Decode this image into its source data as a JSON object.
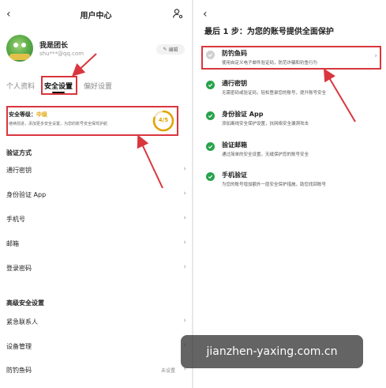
{
  "left": {
    "back_glyph": "‹",
    "title": "用户中心",
    "user": {
      "name": "我是团长",
      "email": "shu***@qq.com"
    },
    "edit_label": "编辑",
    "tabs": [
      "个人资料",
      "安全设置",
      "偏好设置"
    ],
    "security": {
      "level_label": "安全等级：",
      "level_value": "中级",
      "level_desc": "继续前进，添加更多安全设置，为您的账号安全保驾护航",
      "score": "4/5",
      "score_fraction": 0.8
    },
    "section1": "验证方式",
    "verify_items": [
      "通行密钥",
      "身份验证 App",
      "手机号",
      "邮箱",
      "登录密码"
    ],
    "section2": "高级安全设置",
    "advanced_items": [
      {
        "label": "紧急联系人",
        "status": ""
      },
      {
        "label": "设备管理",
        "status": ""
      },
      {
        "label": "防钓鱼码",
        "status": "未设置"
      }
    ]
  },
  "right": {
    "back_glyph": "‹",
    "title": "最后 1 步：为您的账号提供全面保护",
    "steps": [
      {
        "title": "防钓鱼码",
        "desc": "使用自定义电子邮件验证码，防范诈骗和钓鱼行为",
        "done": false
      },
      {
        "title": "通行密钥",
        "desc": "无需密码或验证码，轻松登录您的账号，提升账号安全",
        "done": true
      },
      {
        "title": "身份验证 App",
        "desc": "添加离线安全保护设置，抗网络安全漏洞攻击",
        "done": true
      },
      {
        "title": "验证邮箱",
        "desc": "通过简单的安全设置，无缝保护您的账号安全",
        "done": true
      },
      {
        "title": "手机验证",
        "desc": "为您的账号增加额外一层安全保护措施，助您找回账号",
        "done": true
      }
    ]
  },
  "colors": {
    "highlight": "#d9363e",
    "check": "#27a34a",
    "level": "#e0a300"
  },
  "watermark": "jianzhen-yaxing.com.cn"
}
